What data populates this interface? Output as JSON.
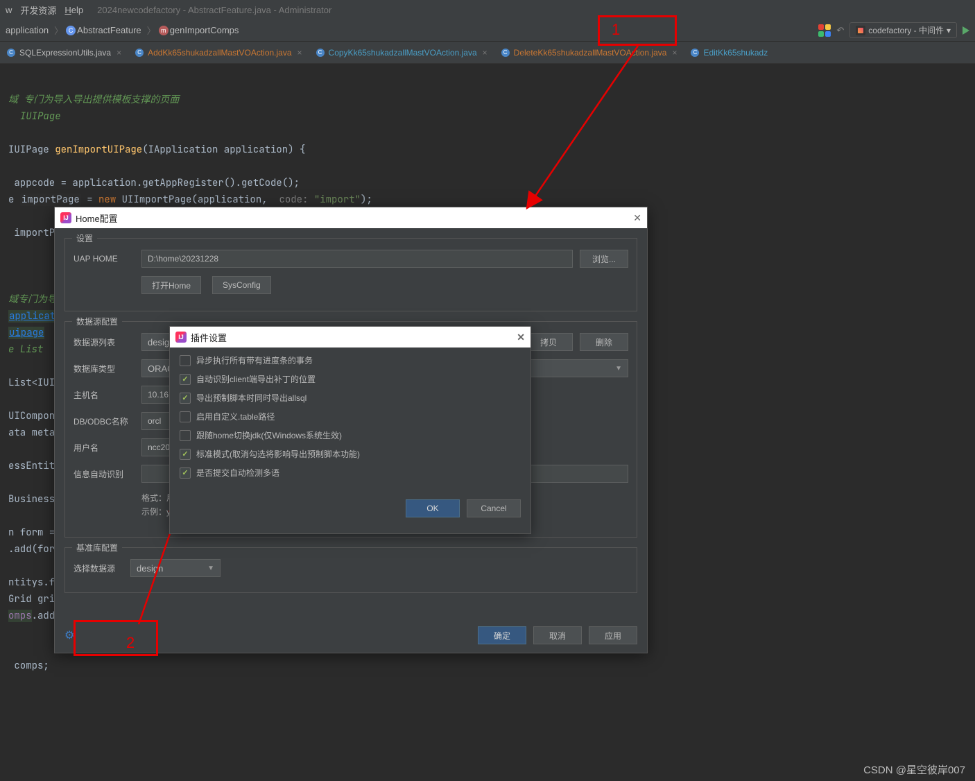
{
  "titlebar": {
    "menu_w": "w",
    "menu_dev": "开发资源",
    "menu_help": "Help",
    "title": "2024newcodefactory - AbstractFeature.java - Administrator"
  },
  "nav": {
    "breadcrumb1": "application",
    "breadcrumb2": "AbstractFeature",
    "breadcrumb3": "genImportComps",
    "run_config": "codefactory - 中间件",
    "run_config_arrow": "▾"
  },
  "tabs": [
    {
      "label": "SQLExpressionUtils.java",
      "mod": false
    },
    {
      "label": "AddKk65shukadzallMastVOAction.java",
      "mod": true,
      "hl": true
    },
    {
      "label": "CopyKk65shukadzallMastVOAction.java",
      "mod": true
    },
    {
      "label": "DeleteKk65shukadzallMastVOAction.java",
      "mod": true,
      "hl": true
    },
    {
      "label": "EditKk65shukadz",
      "mod": true
    }
  ],
  "code": {
    "c1": "域 专门为导入导出提供模板支撑的页面",
    "c2": "IUIPage",
    "sig_ret": "IUIPage ",
    "sig_fn": "genImportUIPage",
    "sig_open": "(IApplication application) {",
    "l_appcode_a": "appcode",
    "l_appcode_b": " = application.getAppRegister().getCode();",
    "l_ip_a": "e ",
    "l_ip_box": "importPage",
    "l_ip_b": " = ",
    "l_ip_new": "new ",
    "l_ip_c": "UIImportPage(application,  ",
    "l_ip_p": "code: ",
    "l_ip_s": "\"import\"",
    "l_ip_end": ");",
    "l_retpart": " importPa",
    "cm_domain": "域专门为导入",
    "link1": "application",
    "link2": "uipage",
    "cm_list": "e List",
    "l_list": "List<IUIC",
    "l_uic": "UIComponen",
    "l_meta": "ata metad",
    "l_ess": "essEntity",
    "l_bus": "BusinessE",
    "l_form_a": "n form = ",
    "l_form_new": "n",
    "l_add": ".add(form)",
    "l_ent": "ntitys.fc",
    "l_grid": "Grid gric",
    "l_comps_a": "omps",
    "l_comps_b": ".add(g",
    "l_ret": " comps;"
  },
  "home_modal": {
    "title": "Home配置",
    "legend_settings": "设置",
    "uap_label": "UAP HOME",
    "uap_value": "D:\\home\\20231228",
    "browse": "浏览...",
    "open_home": "打开Home",
    "sysconfig": "SysConfig",
    "legend_ds": "数据源配置",
    "ds_list_label": "数据源列表",
    "ds_list_value": "design",
    "copy": "拷贝",
    "delete": "删除",
    "db_type_label": "数据库类型",
    "db_type_value": "ORACL",
    "host_label": "主机名",
    "host_value": "10.16.",
    "odbc_label": "DB/ODBC名称",
    "odbc_value": "orcl",
    "user_label": "用户名",
    "user_value": "ncc202",
    "auto_label": "信息自动识别",
    "fmt": "格式：用户名/密码@IP:port/odbc名称",
    "example": "示例：yonbip_2023/password@127.0.0.1:1521/orcl",
    "legend_base": "基准库配置",
    "base_label": "选择数据源",
    "base_value": "design",
    "ok": "确定",
    "cancel": "取消",
    "apply": "应用"
  },
  "plugin_modal": {
    "title": "插件设置",
    "chk1": "异步执行所有带有进度条的事务",
    "chk2": "自动识别client端导出补丁的位置",
    "chk3": "导出预制脚本时同时导出allsql",
    "chk4": "启用自定义.table路径",
    "chk5": "跟随home切换jdk(仅Windows系统生效)",
    "chk6": "标准模式(取消勾选将影响导出预制脚本功能)",
    "chk7": "是否提交自动检测多语",
    "ok": "OK",
    "cancel": "Cancel"
  },
  "anno": {
    "n1": "1",
    "n2": "2"
  },
  "watermark": "CSDN @星空彼岸007"
}
